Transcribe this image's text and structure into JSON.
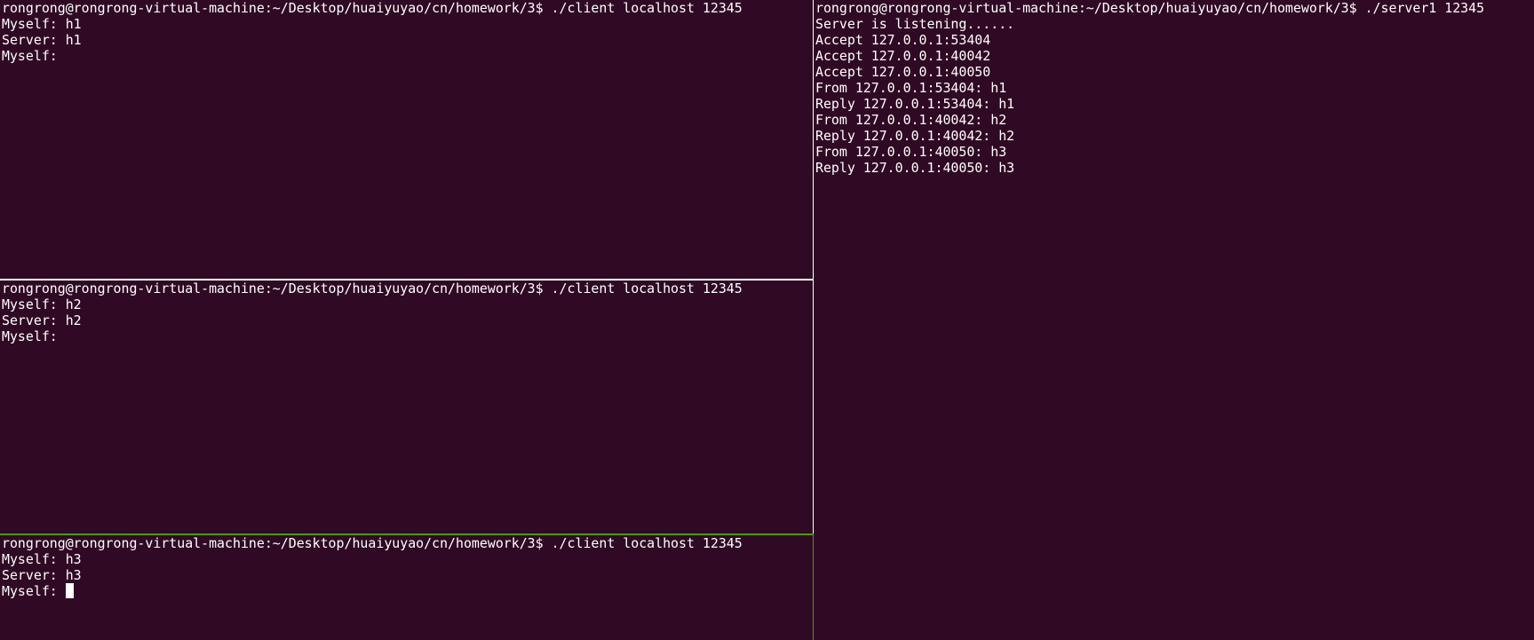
{
  "colors": {
    "terminal_background": "#300a24",
    "terminal_foreground": "#ffffff",
    "active_border": "#4e9a06",
    "inactive_border": "#ffffff"
  },
  "client_panes": [
    {
      "lines": [
        "rongrong@rongrong-virtual-machine:~/Desktop/huaiyuyao/cn/homework/3$ ./client localhost 12345",
        "Myself: h1",
        "Server: h1",
        "Myself:"
      ]
    },
    {
      "lines": [
        "rongrong@rongrong-virtual-machine:~/Desktop/huaiyuyao/cn/homework/3$ ./client localhost 12345",
        "Myself: h2",
        "Server: h2",
        "Myself:"
      ]
    },
    {
      "lines": [
        "rongrong@rongrong-virtual-machine:~/Desktop/huaiyuyao/cn/homework/3$ ./client localhost 12345",
        "Myself: h3",
        "Server: h3",
        "Myself: "
      ]
    }
  ],
  "server_pane": {
    "lines": [
      "rongrong@rongrong-virtual-machine:~/Desktop/huaiyuyao/cn/homework/3$ ./server1 12345",
      "Server is listening......",
      "Accept 127.0.0.1:53404",
      "Accept 127.0.0.1:40042",
      "Accept 127.0.0.1:40050",
      "From 127.0.0.1:53404: h1",
      "Reply 127.0.0.1:53404: h1",
      "From 127.0.0.1:40042: h2",
      "Reply 127.0.0.1:40042: h2",
      "From 127.0.0.1:40050: h3",
      "Reply 127.0.0.1:40050: h3"
    ]
  },
  "cursor_icon": "block-cursor-icon"
}
